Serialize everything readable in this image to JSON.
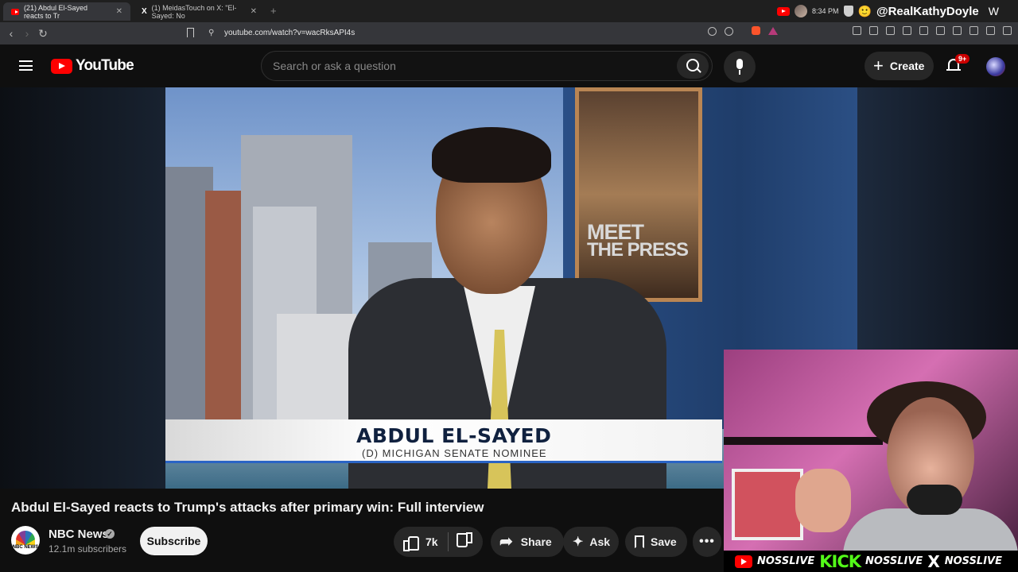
{
  "browser": {
    "tabs": [
      {
        "title": "(21) Abdul El-Sayed reacts to Tr",
        "favicon": "youtube-icon",
        "active": true
      },
      {
        "title": "(1) MeidasTouch on X: \"El-Sayed: No",
        "favicon": "x-icon",
        "active": false
      }
    ],
    "time": "8:34 PM",
    "overlay_handle": "@RealKathyDoyle",
    "overlay_letter": "W",
    "url": "youtube.com/watch?v=wacRksAPI4s"
  },
  "youtube": {
    "logo_text": "YouTube",
    "search_placeholder": "Search or ask a question",
    "create_label": "Create",
    "notification_badge": "9+"
  },
  "video": {
    "broadcast_logo": "MEET THE PRESS",
    "logo_line1": "MEET",
    "logo_line2": "THE PRESS",
    "lower_third_name": "ABDUL EL-SAYED",
    "lower_third_subtitle": "(D) MICHIGAN SENATE NOMINEE",
    "title": "Abdul El-Sayed reacts to Trump's attacks after primary win: Full interview"
  },
  "channel": {
    "avatar_text": "NBC NEWS",
    "name": "NBC News",
    "verified": true,
    "subscribers": "12.1m subscribers",
    "subscribe_label": "Subscribe"
  },
  "actions": {
    "like_count": "7k",
    "share_label": "Share",
    "ask_label": "Ask",
    "save_label": "Save",
    "more_label": "•••"
  },
  "stream_overlay": {
    "brand_items": [
      "NOSSLIVE",
      "KICK",
      "NOSSLIVE",
      "NOSSLIVE"
    ]
  },
  "colors": {
    "youtube_red": "#ff0000",
    "kick_green": "#53fc18",
    "background": "#0f0f0f"
  }
}
